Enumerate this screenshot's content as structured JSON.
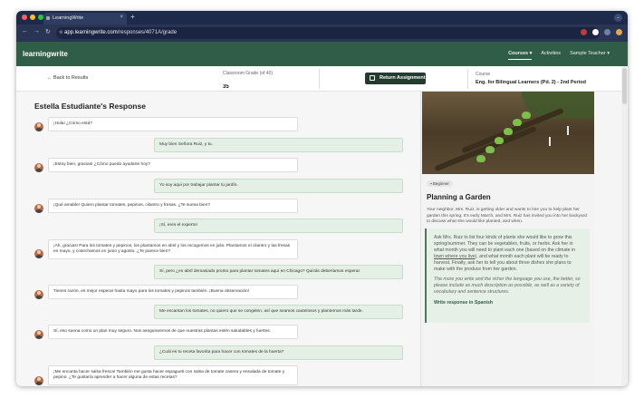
{
  "browser": {
    "tab_title": "LearningWrite",
    "tab_close": "×",
    "new_tab": "+",
    "url_host": "app.learningwrite.com",
    "url_path": "/responses/4071A/grade"
  },
  "app": {
    "logo": "learningwrite",
    "nav": {
      "courses": "Courses ▾",
      "activities": "Activities",
      "user": "Sample Teacher ▾"
    }
  },
  "subheader": {
    "back_label": "Back to Results",
    "grade_label": "Classroom Grade (of 40)",
    "grade_value": "35",
    "return_label": "Return Assignment",
    "course_label": "Course",
    "course_value": "Eng. for Bilingual Learners (Pd. 2) - 2nd Period"
  },
  "response": {
    "title": "Estella Estudiante's Response",
    "messages": [
      {
        "role": "student",
        "text": "¡Hola! ¿Cómo está?"
      },
      {
        "role": "teacher",
        "text": "Muy bien Señora Ruiz, y tu."
      },
      {
        "role": "student",
        "text": "¡Estoy bien, gracias! ¿Cómo puedo ayudarte hoy?"
      },
      {
        "role": "teacher",
        "text": "Yo soy aquí por trabajar plantar tu jardín."
      },
      {
        "role": "student",
        "text": "¡Qué amable! Quiero plantar tomates, pepinos, cilantro y fresas. ¿Te suena bien?"
      },
      {
        "role": "teacher",
        "text": "¡Sí, eres el experto!"
      },
      {
        "role": "student",
        "text": "¡Ah, gracias! Para los tomates y pepinos, los plantamos en abril y los recogemos en julio. Plantamos el cilantro y las fresas en mayo, y cosechamos en junio y agosto. ¿Te parece bien?"
      },
      {
        "role": "teacher",
        "text": "Sí, pero ¿es abril demasiado pronto para plantar tomates aquí en Chicago? Quizás deberíamos esperar."
      },
      {
        "role": "student",
        "text": "Tienes razón, es mejor esperar hasta mayo para los tomates y pepinos también. ¡Buena observación!"
      },
      {
        "role": "teacher",
        "text": "Me encantan los tomates, no quiero que se congelen, así que seamos cautelosos y plantemos más tarde."
      },
      {
        "role": "student",
        "text": "Sí, eso suena como un plan muy seguro. Nos aseguraremos de que nuestras plantas estén saludables y fuertes."
      },
      {
        "role": "teacher",
        "text": "¿Cuál es tu receta favorita para hacer con tomates de la huerta?"
      },
      {
        "role": "student",
        "text": "¡Me encanta hacer salsa fresca! También me gusta hacer espagueti con salsa de tomate casera y ensalada de tomate y pepino. ¿Te gustaría aprender a hacer alguna de estas recetas?"
      }
    ]
  },
  "assignment": {
    "badge": "Beginner",
    "title": "Planning a Garden",
    "description": "Your neighbor, Mrs. Ruiz, is getting older and wants to hire you to help plant her garden this spring. It's early March, and Mrs. Ruiz has invited you into her backyard to discuss what she would like planted, and when.",
    "prompt_before": "Ask Mrs. Ruiz to list four kinds of plants she would like to grow this spring/summer. They can be vegetables, fruits, or herbs. Ask her in what month you will need to plant each one (based on the climate in ",
    "prompt_link": "town where you live",
    "prompt_after": "), and what month each plant will be ready to harvest. Finally, ask her to tell you about three dishes she plans to make with the produce from her garden.",
    "note": "The more you write and the richer the language you use, the better, so please include as much description as possible, as well as a variety of vocabulary and sentence structures.",
    "action": "Write response in Spanish"
  },
  "colors": {
    "header_green": "#2f5d48",
    "teacher_bubble": "#e4efe5",
    "button_dark": "#243b30"
  }
}
